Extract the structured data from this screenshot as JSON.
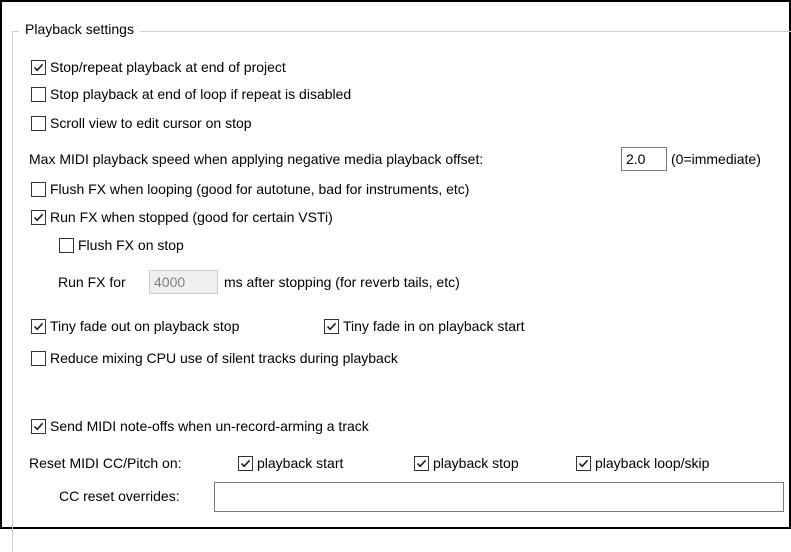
{
  "group_title": "Playback settings",
  "stop_repeat": {
    "label": "Stop/repeat playback at end of project",
    "checked": true
  },
  "stop_loop": {
    "label": "Stop playback at end of loop if repeat is disabled",
    "checked": false
  },
  "scroll_view": {
    "label": "Scroll view to edit cursor on stop",
    "checked": false
  },
  "max_midi": {
    "label": "Max MIDI playback speed when applying negative media playback offset:",
    "value": "2.0",
    "hint": "(0=immediate)"
  },
  "flush_fx_loop": {
    "label": "Flush FX when looping (good for autotune, bad for instruments, etc)",
    "checked": false
  },
  "run_fx_stopped": {
    "label": "Run FX when stopped (good for certain VSTi)",
    "checked": true
  },
  "flush_fx_stop": {
    "label": "Flush FX on stop",
    "checked": false
  },
  "run_fx_for": {
    "prefix": "Run FX for",
    "value": "4000",
    "suffix": "ms after stopping (for reverb tails, etc)"
  },
  "tiny_fade_out": {
    "label": "Tiny fade out on playback stop",
    "checked": true
  },
  "tiny_fade_in": {
    "label": "Tiny fade in on playback start",
    "checked": true
  },
  "reduce_cpu": {
    "label": "Reduce mixing CPU use of silent tracks during playback",
    "checked": false
  },
  "send_noteoffs": {
    "label": "Send MIDI note-offs when un-record-arming a track",
    "checked": true
  },
  "reset_midi": {
    "label": "Reset MIDI CC/Pitch on:",
    "playback_start": {
      "label": "playback start",
      "checked": true
    },
    "playback_stop": {
      "label": "playback stop",
      "checked": true
    },
    "playback_loop": {
      "label": "playback loop/skip",
      "checked": true
    }
  },
  "cc_reset": {
    "label": "CC reset overrides:",
    "value": ""
  }
}
